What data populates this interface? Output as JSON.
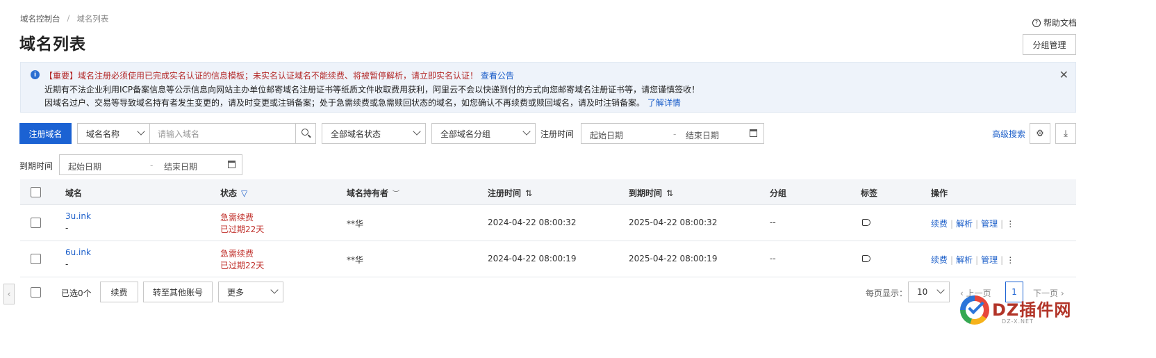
{
  "breadcrumb": {
    "root": "域名控制台",
    "sep": "/",
    "current": "域名列表"
  },
  "page_title": "域名列表",
  "help_link": "帮助文档",
  "group_button": "分组管理",
  "notice": {
    "line1_red": "【重要】域名注册必须使用已完成实名认证的信息模板；未实名认证域名不能续费、将被暂停解析，请立即实名认证！",
    "line1_link": "查看公告",
    "line2": "近期有不法企业利用ICP备案信息等公示信息向网站主办单位邮寄域名注册证书等纸质文件收取费用获利，阿里云不会以快递到付的方式向您邮寄域名注册证书等，请您谨慎签收！",
    "line3": "因域名过户、交易等导致域名持有者发生变更的，请及时变更或注销备案；处于急需续费或急需赎回状态的域名，如您确认不再续费或赎回域名，请及时注销备案。",
    "line3_link": "了解详情"
  },
  "filters": {
    "register_button": "注册域名",
    "name_select": "域名名称",
    "search_placeholder": "请输入域名",
    "status_select": "全部域名状态",
    "group_select": "全部域名分组",
    "reg_time_label": "注册时间",
    "start_date": "起始日期",
    "end_date": "结束日期",
    "date_sep": "-",
    "expire_label": "到期时间",
    "advanced_search": "高级搜索"
  },
  "table": {
    "headers": {
      "domain": "域名",
      "status": "状态",
      "owner": "域名持有者",
      "reg_time": "注册时间",
      "expire_time": "到期时间",
      "group": "分组",
      "tags": "标签",
      "actions": "操作"
    },
    "rows": [
      {
        "domain": "3u.ink",
        "sub": "-",
        "status": "急需续费",
        "status_detail": "已过期22天",
        "owner": "**华",
        "reg_time": "2024-04-22 08:00:32",
        "expire_time": "2025-04-22 08:00:32",
        "group": "--"
      },
      {
        "domain": "6u.ink",
        "sub": "-",
        "status": "急需续费",
        "status_detail": "已过期22天",
        "owner": "**华",
        "reg_time": "2024-04-22 08:00:19",
        "expire_time": "2025-04-22 08:00:19",
        "group": "--"
      }
    ],
    "actions": {
      "renew": "续费",
      "resolve": "解析",
      "manage": "管理",
      "sep": "|",
      "more": "⋮"
    }
  },
  "footer": {
    "selected": "已选0个",
    "renew_button": "续费",
    "transfer_button": "转至其他账号",
    "more_select": "更多",
    "page_size_label": "每页显示：",
    "page_size": "10",
    "prev": "上一页",
    "next": "下一页",
    "current_page": "1"
  },
  "watermark": {
    "text": "DZ插件网",
    "sub": "DZ-X.NET"
  },
  "colors": {
    "primary": "#1b62d3",
    "link": "#1b5ec9",
    "danger": "#c0302b",
    "notice_bg": "#eef3fa"
  }
}
